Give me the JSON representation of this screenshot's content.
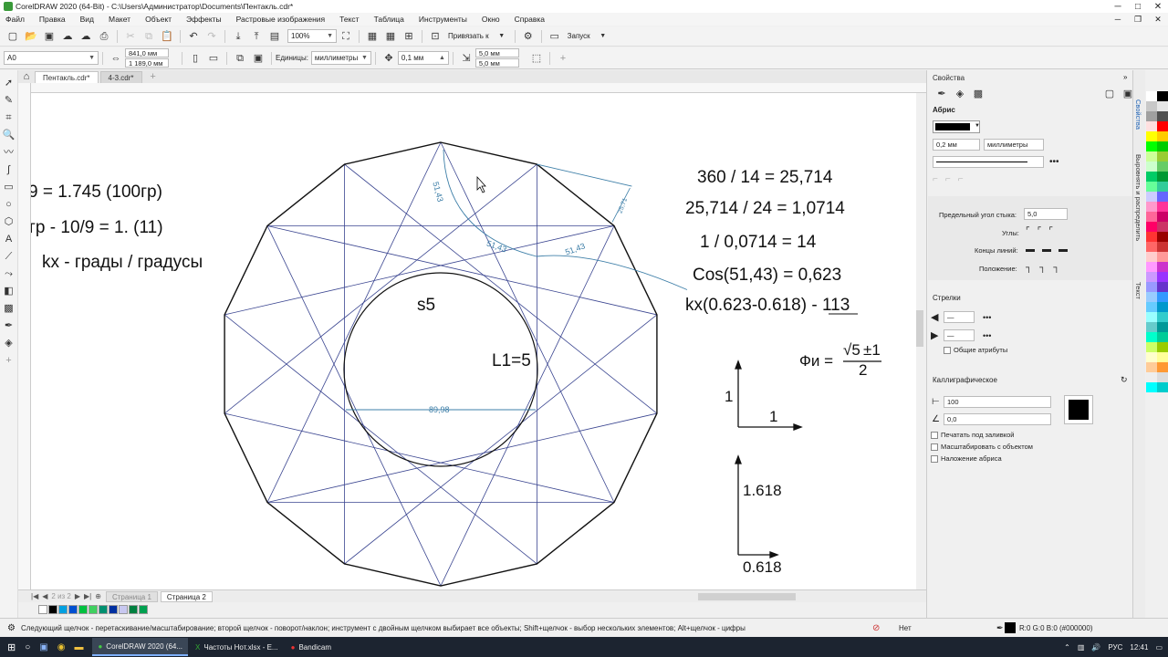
{
  "window": {
    "title": "CorelDRAW 2020 (64-Bit) - C:\\Users\\Администратор\\Documents\\Пентакль.cdr*"
  },
  "menu": [
    "Файл",
    "Правка",
    "Вид",
    "Макет",
    "Объект",
    "Эффекты",
    "Растровые изображения",
    "Текст",
    "Таблица",
    "Инструменты",
    "Окно",
    "Справка"
  ],
  "toolbar": {
    "zoom": "100%",
    "snap_label": "Привязать к",
    "launch_label": "Запуск"
  },
  "propbar": {
    "page_size": "A0",
    "width": "841,0 мм",
    "height": "1 189,0 мм",
    "units_label": "Единицы:",
    "units_value": "миллиметры",
    "nudge": "0,1 мм",
    "dup_x": "5,0 мм",
    "dup_y": "5,0 мм"
  },
  "doc_tabs": [
    "Пентакль.cdr*",
    "4-3.cdr*"
  ],
  "page_tabs": [
    "Страница 1",
    "Страница 2"
  ],
  "canvas_text": {
    "left1": "9 = 1.745 (100гр)",
    "left2": "гр - 10/9 = 1. (11)",
    "left3": "kx - грады / градусы",
    "r1": "360 / 14 = 25,714",
    "r2": "25,714 / 24 = 1,0714",
    "r3": "1 / 0,0714 = 14",
    "r4": "Cos(51,43) = 0,623",
    "r5a": "kx(0.623-0.618) - ",
    "r5b": "113",
    "s5": "s5",
    "l1": "L1=5",
    "phi_label": "Фи =",
    "phi_num_a": "√5",
    "phi_num_b": "±1",
    "phi_den": "2",
    "ax1_v": "1",
    "ax1_h": "1",
    "ax2_v": "1.618",
    "ax2_h": "0.618",
    "dim1": "51,43",
    "dim2": "51,43",
    "dim3": "51,43",
    "dim4": "25,71",
    "dim5": "89,98"
  },
  "dock": {
    "panel_title": "Свойства",
    "outline_head": "Абрис",
    "outline_width": "0,2 мм",
    "outline_units": "миллиметры",
    "miter_label": "Предельный угол стыка:",
    "miter_value": "5,0",
    "corners_label": "Углы:",
    "caps_label": "Концы линий:",
    "position_label": "Положение:",
    "arrows_head": "Стрелки",
    "shared_attr": "Общие атрибуты",
    "callig_head": "Каллиграфическое",
    "callig_stretch": "100",
    "callig_angle": "0,0",
    "print_under": "Печатать под заливкой",
    "scale_with": "Масштабировать с объектом",
    "overprint": "Наложение абриса"
  },
  "side_tabs": [
    "Свойства",
    "Выровнять и распределить",
    "Текст"
  ],
  "status": {
    "hint": "Следующий щелчок - перетаскивание/масштабирование; второй щелчок - поворот/наклон; инструмент с двойным щелчком выбирает все объекты; Shift+щелчок - выбор нескольких элементов; Alt+щелчок - цифры",
    "fill_none": "Нет",
    "outline_color": "R:0 G:0 B:0 (#000000)"
  },
  "taskbar": {
    "apps": [
      "CorelDRAW 2020 (64...",
      "Частоты Нот.xlsx - E...",
      "Bandicam"
    ],
    "lang": "РУС",
    "time": "12:41"
  },
  "colors": {
    "accent": "#4a5a9a",
    "geometry": "#3a4590",
    "dims": "#3e7fa8"
  }
}
